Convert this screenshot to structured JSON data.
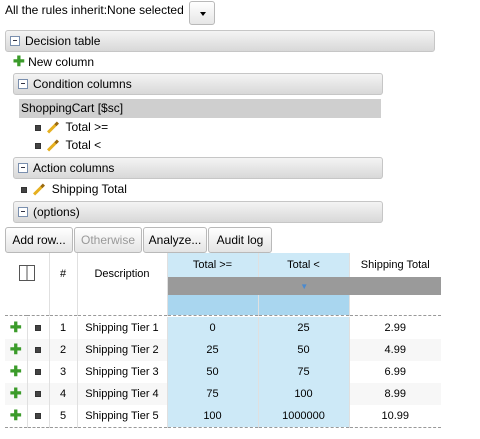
{
  "inherit": {
    "label": "All the rules inherit:",
    "value": "None selected"
  },
  "sections": {
    "decision_table": "Decision table",
    "new_column": "New column",
    "condition_columns": "Condition columns",
    "pattern": "ShoppingCart [$sc]",
    "conditions": [
      "Total >=",
      "Total <"
    ],
    "action_columns": "Action columns",
    "actions": [
      "Shipping Total"
    ],
    "options": "(options)"
  },
  "toolbar": {
    "add_row": "Add row...",
    "otherwise": "Otherwise",
    "analyze": "Analyze...",
    "audit_log": "Audit log"
  },
  "table": {
    "headers": {
      "num": "#",
      "description": "Description",
      "total_ge": "Total >=",
      "total_lt": "Total <",
      "shipping": "Shipping Total"
    },
    "rows": [
      {
        "num": "1",
        "desc": "Shipping Tier 1",
        "ge": "0",
        "lt": "25",
        "ship": "2.99"
      },
      {
        "num": "2",
        "desc": "Shipping Tier 2",
        "ge": "25",
        "lt": "50",
        "ship": "4.99"
      },
      {
        "num": "3",
        "desc": "Shipping Tier 3",
        "ge": "50",
        "lt": "75",
        "ship": "6.99"
      },
      {
        "num": "4",
        "desc": "Shipping Tier 4",
        "ge": "75",
        "lt": "100",
        "ship": "8.99"
      },
      {
        "num": "5",
        "desc": "Shipping Tier 5",
        "ge": "100",
        "lt": "1000000",
        "ship": "10.99"
      }
    ]
  }
}
